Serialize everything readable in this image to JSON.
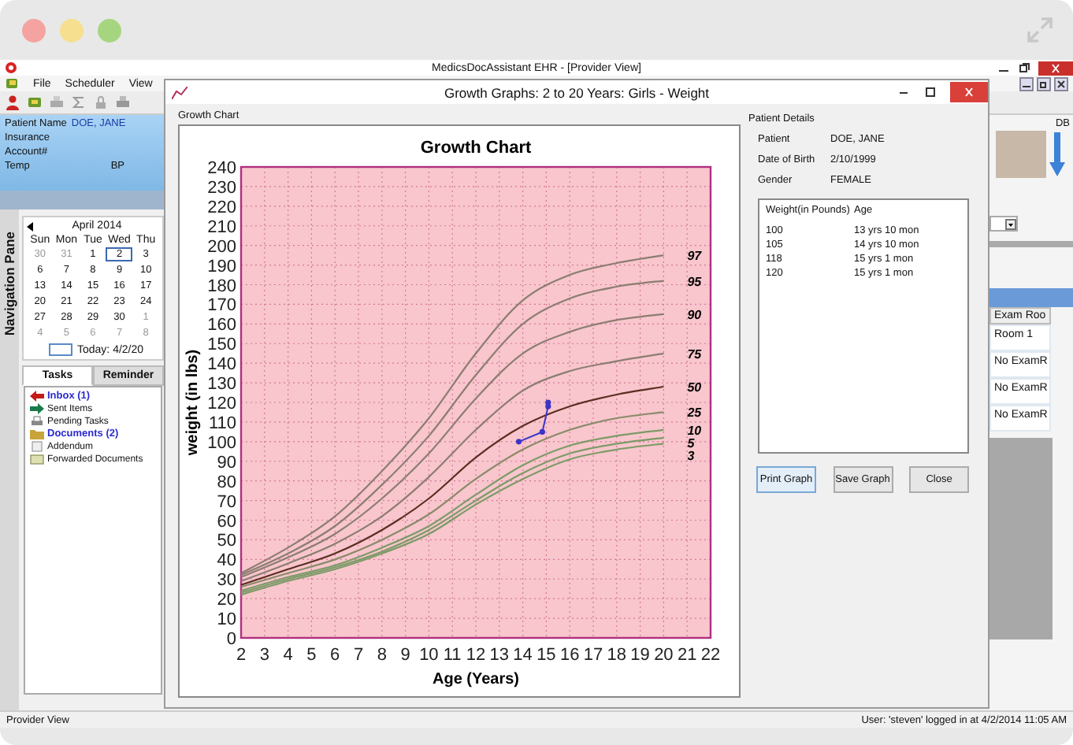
{
  "app": {
    "title": "MedicsDocAssistant EHR - [Provider View]",
    "menu": [
      "File",
      "Scheduler",
      "View"
    ]
  },
  "patient_banner": {
    "rows": [
      {
        "label": "Patient Name",
        "value": "DOE, JANE"
      },
      {
        "label": "Insurance"
      },
      {
        "label": "Account#"
      }
    ],
    "vitals": [
      "Temp",
      "BP"
    ]
  },
  "navigation_pane": {
    "title": "Navigation Pane"
  },
  "calendar": {
    "month": "April 2014",
    "weekdays": [
      "Sun",
      "Mon",
      "Tue",
      "Wed",
      "Thu"
    ],
    "weeks": [
      [
        {
          "day": "30",
          "other_month": true,
          "selected": false
        },
        {
          "day": "31",
          "other_month": true,
          "selected": false
        },
        {
          "day": "1",
          "other_month": false,
          "selected": false
        },
        {
          "day": "2",
          "other_month": false,
          "selected": true
        },
        {
          "day": "3",
          "other_month": false,
          "selected": false
        }
      ],
      [
        {
          "day": "6",
          "other_month": false,
          "selected": false
        },
        {
          "day": "7",
          "other_month": false,
          "selected": false
        },
        {
          "day": "8",
          "other_month": false,
          "selected": false
        },
        {
          "day": "9",
          "other_month": false,
          "selected": false
        },
        {
          "day": "10",
          "other_month": false,
          "selected": false
        }
      ],
      [
        {
          "day": "13",
          "other_month": false,
          "selected": false
        },
        {
          "day": "14",
          "other_month": false,
          "selected": false
        },
        {
          "day": "15",
          "other_month": false,
          "selected": false
        },
        {
          "day": "16",
          "other_month": false,
          "selected": false
        },
        {
          "day": "17",
          "other_month": false,
          "selected": false
        }
      ],
      [
        {
          "day": "20",
          "other_month": false,
          "selected": false
        },
        {
          "day": "21",
          "other_month": false,
          "selected": false
        },
        {
          "day": "22",
          "other_month": false,
          "selected": false
        },
        {
          "day": "23",
          "other_month": false,
          "selected": false
        },
        {
          "day": "24",
          "other_month": false,
          "selected": false
        }
      ],
      [
        {
          "day": "27",
          "other_month": false,
          "selected": false
        },
        {
          "day": "28",
          "other_month": false,
          "selected": false
        },
        {
          "day": "29",
          "other_month": false,
          "selected": false
        },
        {
          "day": "30",
          "other_month": false,
          "selected": false
        },
        {
          "day": "1",
          "other_month": true,
          "selected": false
        }
      ],
      [
        {
          "day": "4",
          "other_month": true,
          "selected": false
        },
        {
          "day": "5",
          "other_month": true,
          "selected": false
        },
        {
          "day": "6",
          "other_month": true,
          "selected": false
        },
        {
          "day": "7",
          "other_month": true,
          "selected": false
        },
        {
          "day": "8",
          "other_month": true,
          "selected": false
        }
      ]
    ],
    "today": "Today: 4/2/20"
  },
  "tabs": [
    {
      "label": "Tasks",
      "selected": true
    },
    {
      "label": "Reminder",
      "selected": false
    }
  ],
  "tasks": {
    "items": [
      {
        "kind": "inbox",
        "label": "Inbox (1)",
        "unread": true
      },
      {
        "kind": "sent",
        "label": "Sent Items",
        "unread": false
      },
      {
        "kind": "pending",
        "label": "Pending Tasks",
        "unread": false
      },
      {
        "kind": "documents",
        "label": "Documents (2)",
        "unread": true
      },
      {
        "kind": "addendum",
        "label": "Addendum",
        "unread": false
      },
      {
        "kind": "forwarded",
        "label": "Forwarded Documents",
        "unread": false
      }
    ]
  },
  "right_pane": {
    "user_initials": "DB",
    "column_header": "Exam Roo",
    "rows": [
      "Room 1",
      "No ExamR",
      "No ExamR",
      "No ExamR"
    ]
  },
  "dialog": {
    "title": "Growth Graphs: 2 to 20 Years: Girls - Weight",
    "chart_group_label": "Growth Chart",
    "chart_data": {
      "type": "line",
      "title": "Growth Chart",
      "xlabel": "Age (Years)",
      "ylabel": "weight (in lbs)",
      "x": [
        2,
        4,
        6,
        8,
        10,
        12,
        14,
        16,
        18,
        20
      ],
      "grid": true,
      "xlim": [
        2,
        22
      ],
      "ylim": [
        0,
        240
      ],
      "xticks": [
        2,
        3,
        4,
        5,
        6,
        7,
        8,
        9,
        10,
        11,
        12,
        13,
        14,
        15,
        16,
        17,
        18,
        19,
        20,
        21,
        22
      ],
      "yticks": [
        0,
        10,
        20,
        30,
        40,
        50,
        60,
        70,
        80,
        90,
        100,
        110,
        120,
        130,
        140,
        150,
        160,
        170,
        180,
        190,
        200,
        210,
        220,
        230,
        240
      ],
      "series": [
        {
          "name": "97",
          "color": "#8c7d72",
          "values": [
            33,
            46,
            62,
            85,
            112,
            145,
            172,
            185,
            191,
            195
          ]
        },
        {
          "name": "95",
          "color": "#8c7d72",
          "values": [
            32,
            43,
            57,
            78,
            103,
            134,
            160,
            173,
            179,
            182
          ]
        },
        {
          "name": "90",
          "color": "#8c7d72",
          "values": [
            31,
            41,
            53,
            71,
            94,
            122,
            145,
            156,
            162,
            165
          ]
        },
        {
          "name": "75",
          "color": "#8c7d72",
          "values": [
            29,
            38,
            48,
            62,
            82,
            106,
            126,
            136,
            141,
            145
          ]
        },
        {
          "name": "50",
          "color": "#5a2e22",
          "values": [
            27,
            35,
            43,
            55,
            71,
            92,
            108,
            118,
            124,
            128
          ]
        },
        {
          "name": "25",
          "color": "#8a8a6a",
          "values": [
            26,
            33,
            40,
            50,
            63,
            81,
            96,
            106,
            112,
            115
          ]
        },
        {
          "name": "10",
          "color": "#7d9a68",
          "values": [
            24,
            31,
            37,
            46,
            57,
            73,
            88,
            98,
            103,
            106
          ]
        },
        {
          "name": "5",
          "color": "#7d9a68",
          "values": [
            23,
            30,
            36,
            44,
            55,
            70,
            84,
            94,
            99,
            102
          ]
        },
        {
          "name": "3",
          "color": "#7d9a68",
          "values": [
            22,
            29,
            35,
            43,
            53,
            68,
            81,
            91,
            96,
            99
          ]
        },
        {
          "color": "#3b35c8",
          "marker": "circle",
          "x": [
            13.83,
            14.83,
            15.08,
            15.08
          ],
          "values": [
            100,
            105,
            118,
            120
          ]
        }
      ]
    },
    "patient_details": {
      "heading": "Patient Details",
      "rows": [
        {
          "label": "Patient",
          "value": "DOE, JANE"
        },
        {
          "label": "Date of Birth",
          "value": "2/10/1999"
        },
        {
          "label": "Gender",
          "value": "FEMALE"
        }
      ]
    },
    "measurements": {
      "columns": [
        "Weight(in Pounds)",
        "Age"
      ],
      "rows": [
        [
          "100",
          "13 yrs 10 mon"
        ],
        [
          "105",
          "14 yrs 10 mon"
        ],
        [
          "118",
          "15 yrs 1 mon"
        ],
        [
          "120",
          "15 yrs 1 mon"
        ]
      ]
    },
    "buttons": [
      "Print Graph",
      "Save Graph",
      "Close"
    ]
  },
  "status_bar": {
    "left": "Provider View",
    "right": "User: 'steven' logged in at 4/2/2014 11:05 AM"
  }
}
